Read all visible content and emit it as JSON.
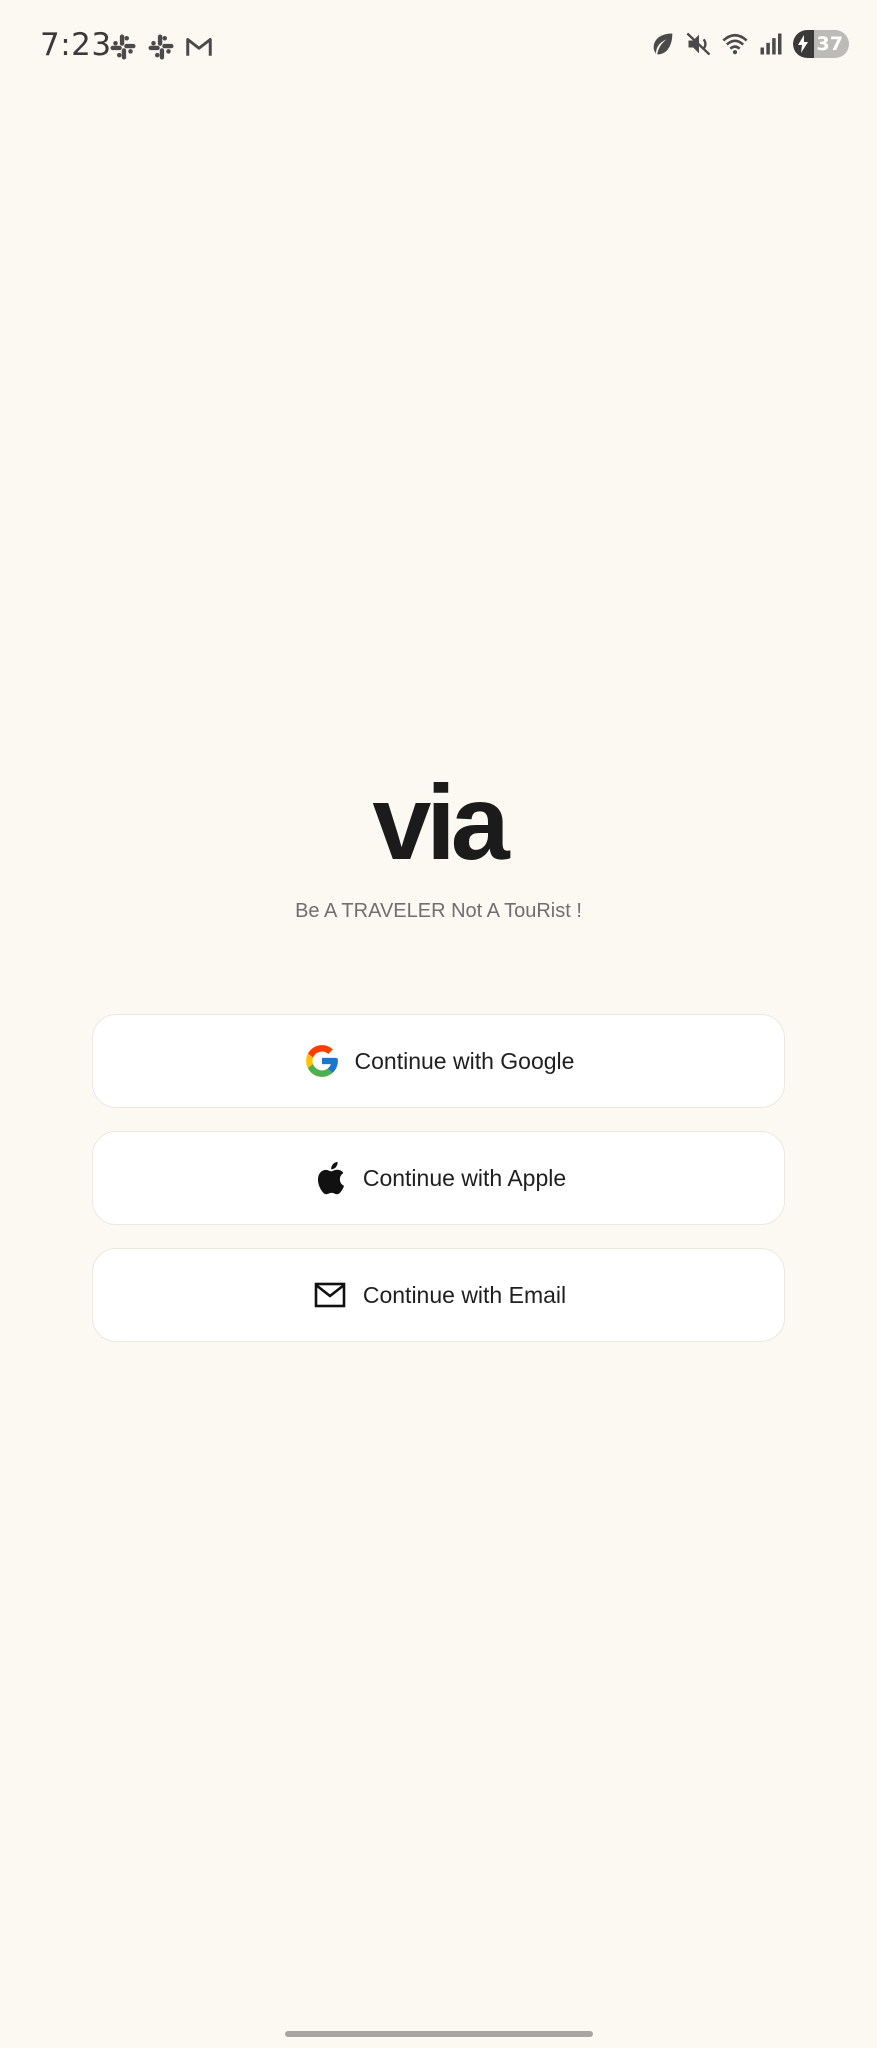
{
  "status_bar": {
    "time": "7:23",
    "left_icons": [
      "slack-icon",
      "slack-icon",
      "gmail-icon"
    ],
    "right_icons": [
      "leaf-icon",
      "mute-icon",
      "wifi-icon",
      "signal-icon"
    ],
    "battery_percent": "37",
    "battery_charging": true
  },
  "app": {
    "logo": "via",
    "tagline": "Be A TRAVELER Not A TouRist !"
  },
  "auth": {
    "google_label": "Continue with Google",
    "apple_label": "Continue with Apple",
    "email_label": "Continue with Email"
  },
  "colors": {
    "background": "#fcf9f3",
    "button_bg": "#ffffff",
    "button_border": "#ece8e0",
    "text_primary": "#1b1b1b",
    "text_secondary": "#6f6f6f"
  }
}
